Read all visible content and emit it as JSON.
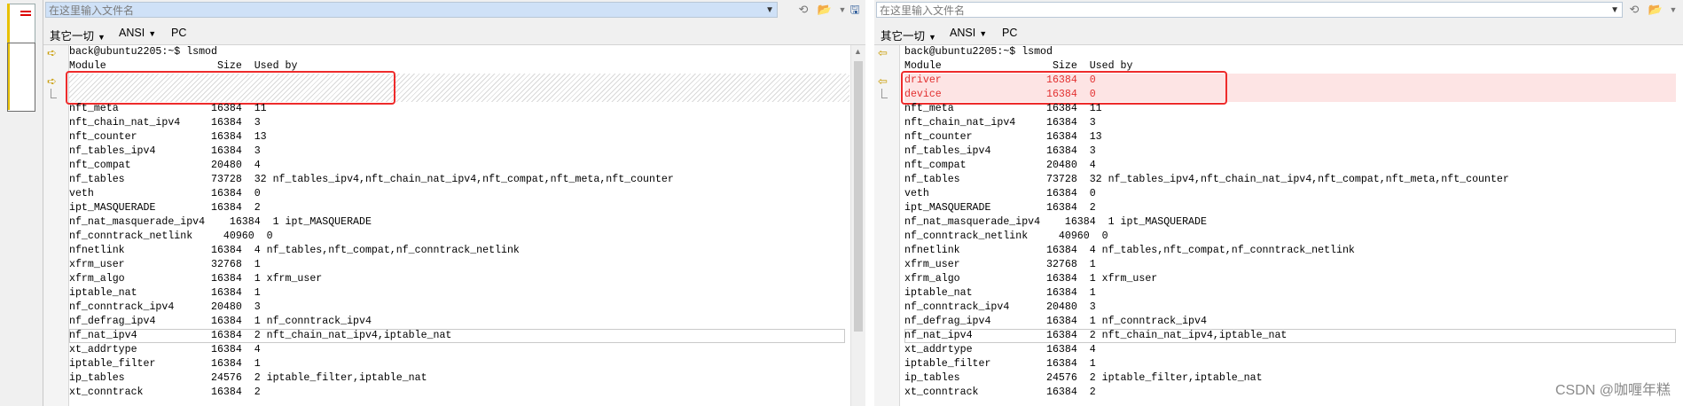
{
  "left": {
    "path_placeholder": "在这里输入文件名",
    "menu": [
      "其它一切",
      "ANSI",
      "PC"
    ],
    "prompt": "back@ubuntu2205:~$ lsmod",
    "header": "Module                  Size  Used by",
    "rows": [
      "nft_meta               16384  11",
      "nft_chain_nat_ipv4     16384  3",
      "nft_counter            16384  13",
      "nf_tables_ipv4         16384  3",
      "nft_compat             20480  4",
      "nf_tables              73728  32 nf_tables_ipv4,nft_chain_nat_ipv4,nft_compat,nft_meta,nft_counter",
      "veth                   16384  0",
      "ipt_MASQUERADE         16384  2",
      "nf_nat_masquerade_ipv4    16384  1 ipt_MASQUERADE",
      "nf_conntrack_netlink     40960  0",
      "nfnetlink              16384  4 nf_tables,nft_compat,nf_conntrack_netlink",
      "xfrm_user              32768  1",
      "xfrm_algo              16384  1 xfrm_user",
      "iptable_nat            16384  1",
      "nf_conntrack_ipv4      20480  3",
      "nf_defrag_ipv4         16384  1 nf_conntrack_ipv4",
      "nf_nat_ipv4            16384  2 nft_chain_nat_ipv4,iptable_nat",
      "xt_addrtype            16384  4",
      "iptable_filter         16384  1",
      "ip_tables              24576  2 iptable_filter,iptable_nat",
      "xt_conntrack           16384  2"
    ]
  },
  "right": {
    "path_placeholder": "在这里输入文件名",
    "menu": [
      "其它一切",
      "ANSI",
      "PC"
    ],
    "prompt": "back@ubuntu2205:~$ lsmod",
    "header": "Module                  Size  Used by",
    "added_rows": [
      "driver                 16384  0",
      "device                 16384  0"
    ],
    "rows": [
      "nft_meta               16384  11",
      "nft_chain_nat_ipv4     16384  3",
      "nft_counter            16384  13",
      "nf_tables_ipv4         16384  3",
      "nft_compat             20480  4",
      "nf_tables              73728  32 nf_tables_ipv4,nft_chain_nat_ipv4,nft_compat,nft_meta,nft_counter",
      "veth                   16384  0",
      "ipt_MASQUERADE         16384  2",
      "nf_nat_masquerade_ipv4    16384  1 ipt_MASQUERADE",
      "nf_conntrack_netlink     40960  0",
      "nfnetlink              16384  4 nf_tables,nft_compat,nf_conntrack_netlink",
      "xfrm_user              32768  1",
      "xfrm_algo              16384  1 xfrm_user",
      "iptable_nat            16384  1",
      "nf_conntrack_ipv4      20480  3",
      "nf_defrag_ipv4         16384  1 nf_conntrack_ipv4",
      "nf_nat_ipv4            16384  2 nft_chain_nat_ipv4,iptable_nat",
      "xt_addrtype            16384  4",
      "iptable_filter         16384  1",
      "ip_tables              24576  2 iptable_filter,iptable_nat",
      "xt_conntrack           16384  2"
    ]
  },
  "icons": {
    "history": "history-icon",
    "open": "folder-open-icon",
    "save": "save-icon",
    "diff_marker": "yellow-arrow-icon"
  },
  "colors": {
    "added_text": "#e23030",
    "added_bg": "#fde4e4",
    "highlight_box": "#ee2b2b"
  },
  "watermark": "CSDN @咖喱年糕"
}
